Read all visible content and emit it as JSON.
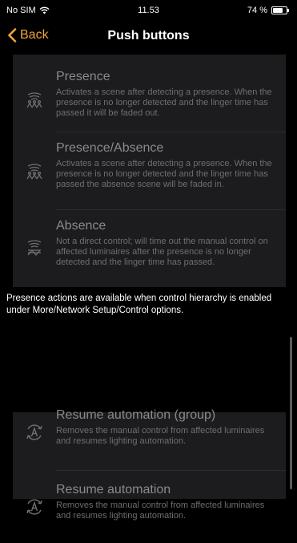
{
  "status_bar": {
    "carrier": "No SIM",
    "time": "11.53",
    "battery": "74 %"
  },
  "nav": {
    "back_label": "Back",
    "title": "Push buttons"
  },
  "items_presence": [
    {
      "title": "Presence",
      "description": "Activates a scene after detecting a presence. When the presence is no longer detected and the linger time has passed it will be faded out.",
      "icon": "presence-icon"
    },
    {
      "title": "Presence/Absence",
      "description": "Activates a scene after detecting a presence. When the presence is no longer detected and the linger time has passed the absence scene will be faded in.",
      "icon": "presence-icon"
    },
    {
      "title": "Absence",
      "description": "Not a direct control; will time out the manual control on affected luminaires after the presence is no longer detected and the linger time has passed.",
      "icon": "absence-icon"
    }
  ],
  "notice": "Presence actions are available when control hierarchy is enabled under More/Network Setup/Control options.",
  "items_automation": [
    {
      "title": "Resume automation (group)",
      "description": "Removes the manual control from affected luminaires and resumes lighting automation.",
      "icon": "resume-automation-icon"
    },
    {
      "title": "Resume automation",
      "description": "Removes the manual control from affected luminaires and resumes lighting automation.",
      "icon": "resume-automation-icon"
    }
  ],
  "colors": {
    "accent": "#f2a43a",
    "cell_bg": "#1c1c1e",
    "title_disabled": "#8a8a8e",
    "desc_disabled": "#6e6e73"
  }
}
